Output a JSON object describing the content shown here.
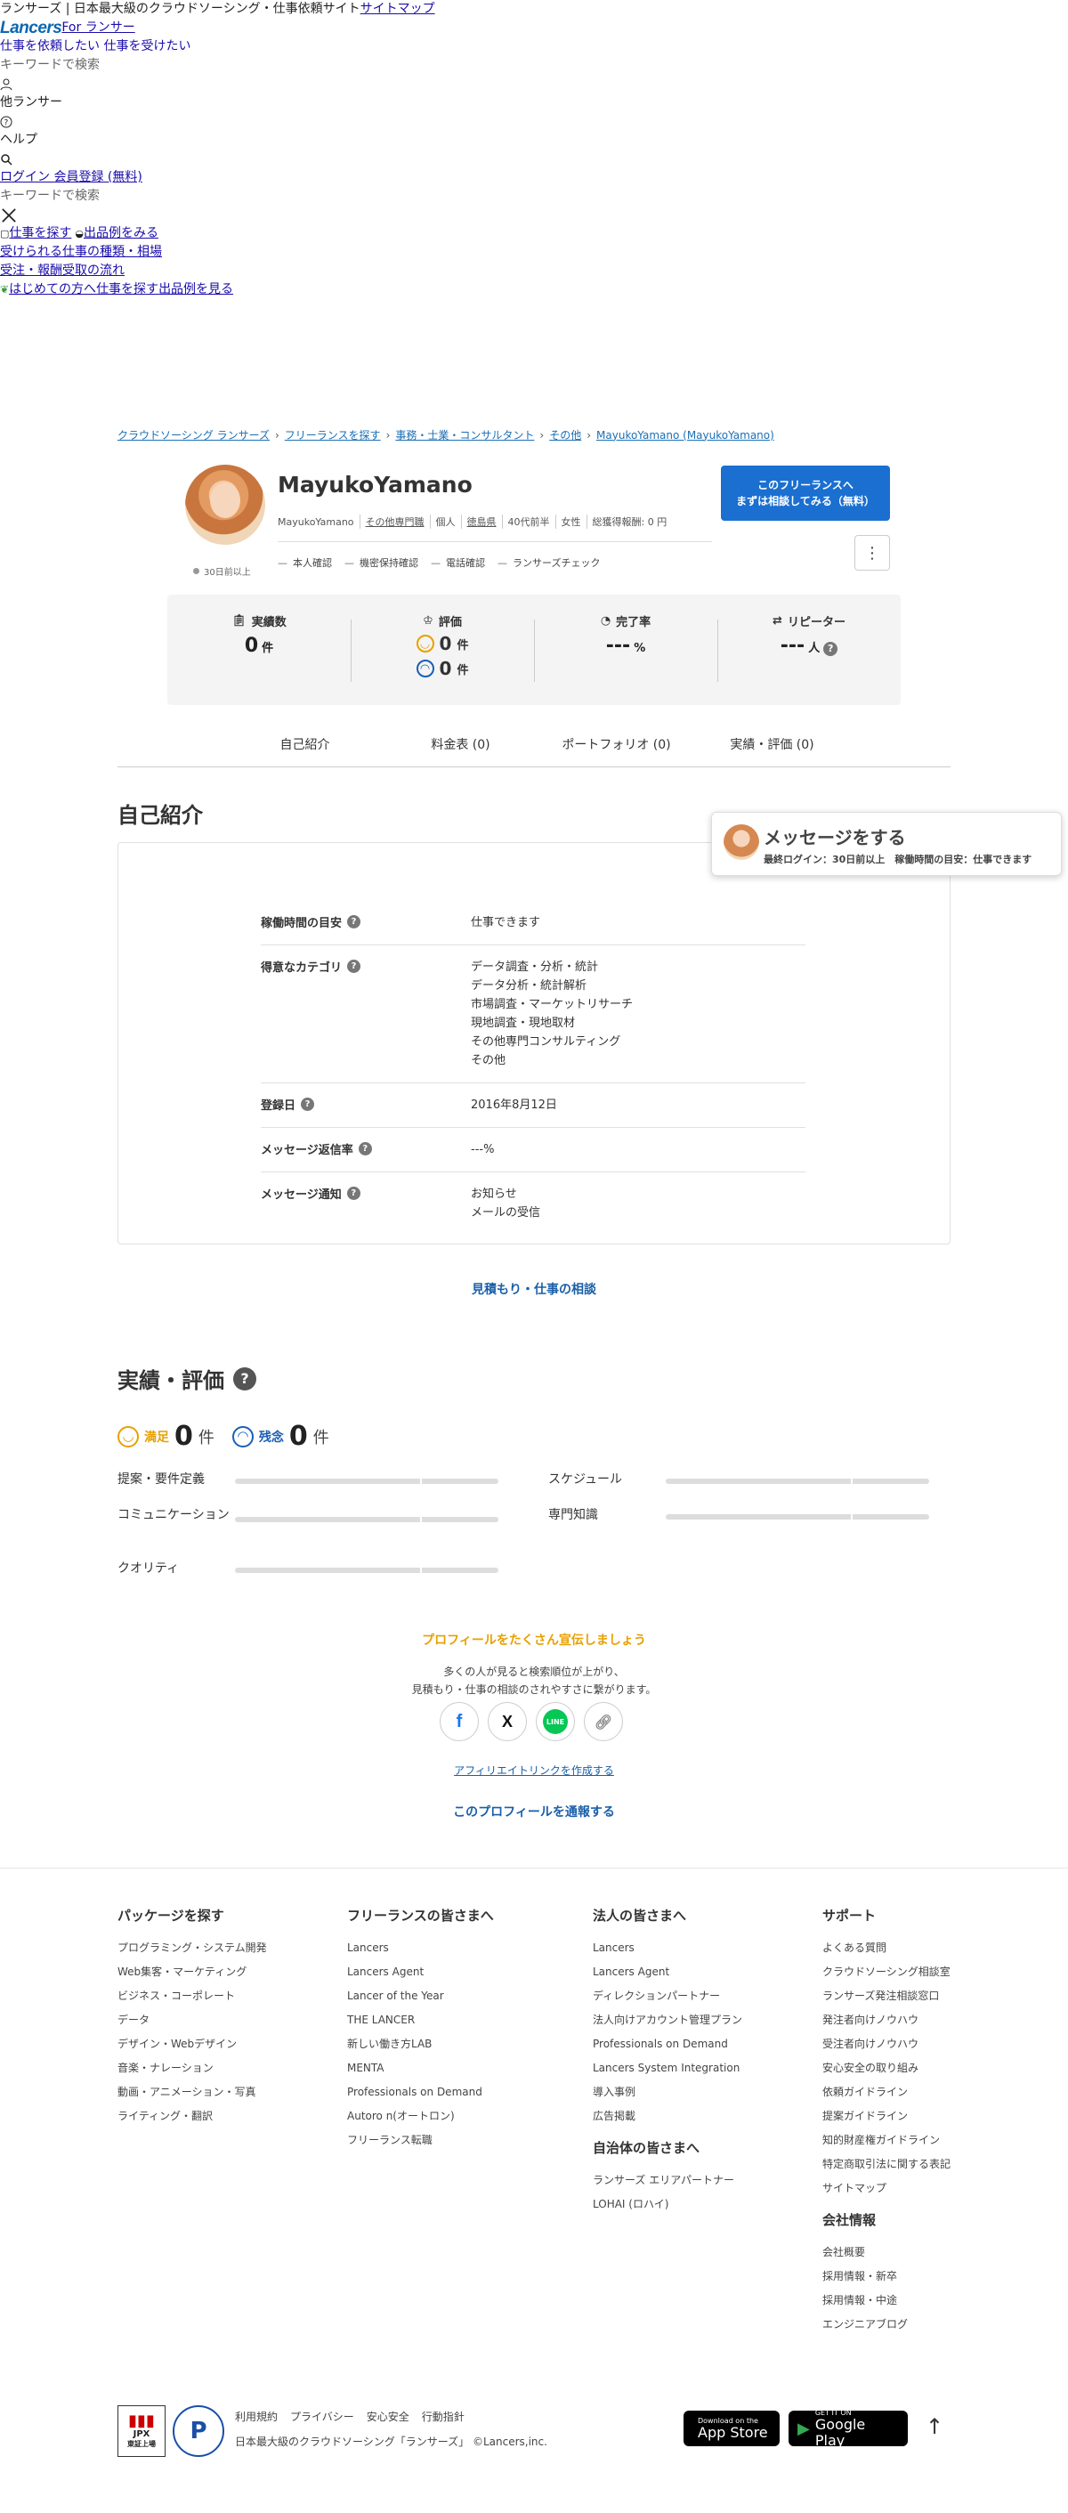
{
  "header": {
    "site_title": "ランサーズ | 日本最大級のクラウドソーシング・仕事依頼サイト",
    "sitemap": "サイトマップ",
    "logo": "Lancers",
    "for_lancer": "For ランサー",
    "tagline": "仕事を依頼したい 仕事を受けたい",
    "search_placeholder": "キーワードで検索",
    "other_lancers": "他ランサー",
    "help": "ヘルプ",
    "login_register": "ログイン 会員登録 (無料)",
    "search_placeholder2": "キーワードで検索",
    "menu": [
      "仕事を探す",
      "出品例をみる",
      "受けられる仕事の種類・相場",
      "受注・報酬受取の流れ",
      "はじめての方へ",
      "仕事を探す",
      "出品例を見る"
    ]
  },
  "breadcrumb": [
    "クラウドソーシング ランサーズ",
    "フリーランスを探す",
    "事務・士業・コンサルタント",
    "その他",
    "MayukoYamano (MayukoYamano)"
  ],
  "profile": {
    "name": "MayukoYamano",
    "last_login": "30日前以上",
    "meta": [
      "MayukoYamano",
      "その他専門職",
      "個人",
      "徳島県",
      "40代前半",
      "女性",
      "総獲得報酬: 0 円"
    ],
    "checks": [
      "本人確認",
      "機密保持確認",
      "電話確認",
      "ランサーズチェック"
    ],
    "cta_line1": "このフリーランスへ",
    "cta_line2": "まずは相談してみる（無料）",
    "more": "⋮"
  },
  "stats": {
    "jisseki_label": "実績数",
    "jisseki_value": "0",
    "jisseki_unit": "件",
    "hyoka_label": "評価",
    "hyoka_good": "0",
    "hyoka_bad": "0",
    "hyoka_unit": "件",
    "kanryo_label": "完了率",
    "kanryo_value": "---",
    "kanryo_unit": "%",
    "repeater_label": "リピーター",
    "repeater_value": "---",
    "repeater_unit": "人"
  },
  "tabs": [
    "自己紹介",
    "料金表 (0)",
    "ポートフォリオ (0)",
    "実績・評価 (0)"
  ],
  "intro": {
    "heading": "自己紹介",
    "rows": [
      {
        "k": "稼働時間の目安",
        "v": "仕事できます"
      },
      {
        "k": "得意なカテゴリ",
        "v": "データ調査・分析・統計\nデータ分析・統計解析\n市場調査・マーケットリサーチ\n現地調査・現地取材\nその他専門コンサルティング\nその他"
      },
      {
        "k": "登録日",
        "v": "2016年8月12日"
      },
      {
        "k": "メッセージ返信率",
        "v": "---%"
      },
      {
        "k": "メッセージ通知",
        "v": "お知らせ\nメールの受信"
      }
    ]
  },
  "message_float": {
    "title": "メッセージをする",
    "sub": "最終ログイン：30日前以上　稼働時間の目安：仕事できます"
  },
  "estimate_link": "見積もり・仕事の相談",
  "reviews": {
    "heading": "実績・評価",
    "good_label": "満足",
    "good_count": "0",
    "bad_label": "残念",
    "bad_count": "0",
    "unit": "件",
    "items": [
      "提案・要件定義",
      "スケジュール",
      "コミュニケーション",
      "専門知識",
      "クオリティ"
    ]
  },
  "promo": {
    "title": "プロフィールをたくさん宣伝しましょう",
    "desc1": "多くの人が見ると検索順位が上がり、",
    "desc2": "見積もり・仕事の相談のされやすさに繋がります。",
    "affiliate": "アフィリエイトリンクを作成する",
    "report": "このプロフィールを通報する"
  },
  "footer": {
    "col1_title": "パッケージを探す",
    "col1": [
      "プログラミング・システム開発",
      "Web集客・マーケティング",
      "ビジネス・コーポレート",
      "データ",
      "デザイン・Webデザイン",
      "音楽・ナレーション",
      "動画・アニメーション・写真",
      "ライティング・翻訳"
    ],
    "col2_title": "フリーランスの皆さまへ",
    "col2": [
      "Lancers",
      "Lancers Agent",
      "Lancer of the Year",
      "THE LANCER",
      "新しい働き方LAB",
      "MENTA",
      "Professionals on Demand",
      "Autoro n(オートロン)",
      "フリーランス転職"
    ],
    "col3_title": "法人の皆さまへ",
    "col3": [
      "Lancers",
      "Lancers Agent",
      "ディレクションパートナー",
      "法人向けアカウント管理プラン",
      "Professionals on Demand",
      "Lancers System Integration",
      "導入事例",
      "広告掲載"
    ],
    "col3b_title": "自治体の皆さまへ",
    "col3b": [
      "ランサーズ エリアパートナー",
      "LOHAI (ロハイ)"
    ],
    "col4_title": "サポート",
    "col4": [
      "よくある質問",
      "クラウドソーシング相談室",
      "ランサーズ発注相談窓口",
      "発注者向けノウハウ",
      "受注者向けノウハウ",
      "安心安全の取り組み",
      "依頼ガイドライン",
      "提案ガイドライン",
      "知的財産権ガイドライン",
      "特定商取引法に関する表記",
      "サイトマップ"
    ],
    "col4b_title": "会社情報",
    "col4b": [
      "会社概要",
      "採用情報・新卒",
      "採用情報・中途",
      "エンジニアブログ"
    ],
    "jpx": "JPX",
    "jpx_sub": "東証上場",
    "links": [
      "利用規約",
      "プライバシー",
      "安心安全",
      "行動指針"
    ],
    "copyright": "日本最大級のクラウドソーシング「ランサーズ」 ©Lancers,inc.",
    "appstore_small": "Download on the",
    "appstore_big": "App Store",
    "gplay_small": "GET IT ON",
    "gplay_big": "Google Play",
    "totop": "↑"
  }
}
